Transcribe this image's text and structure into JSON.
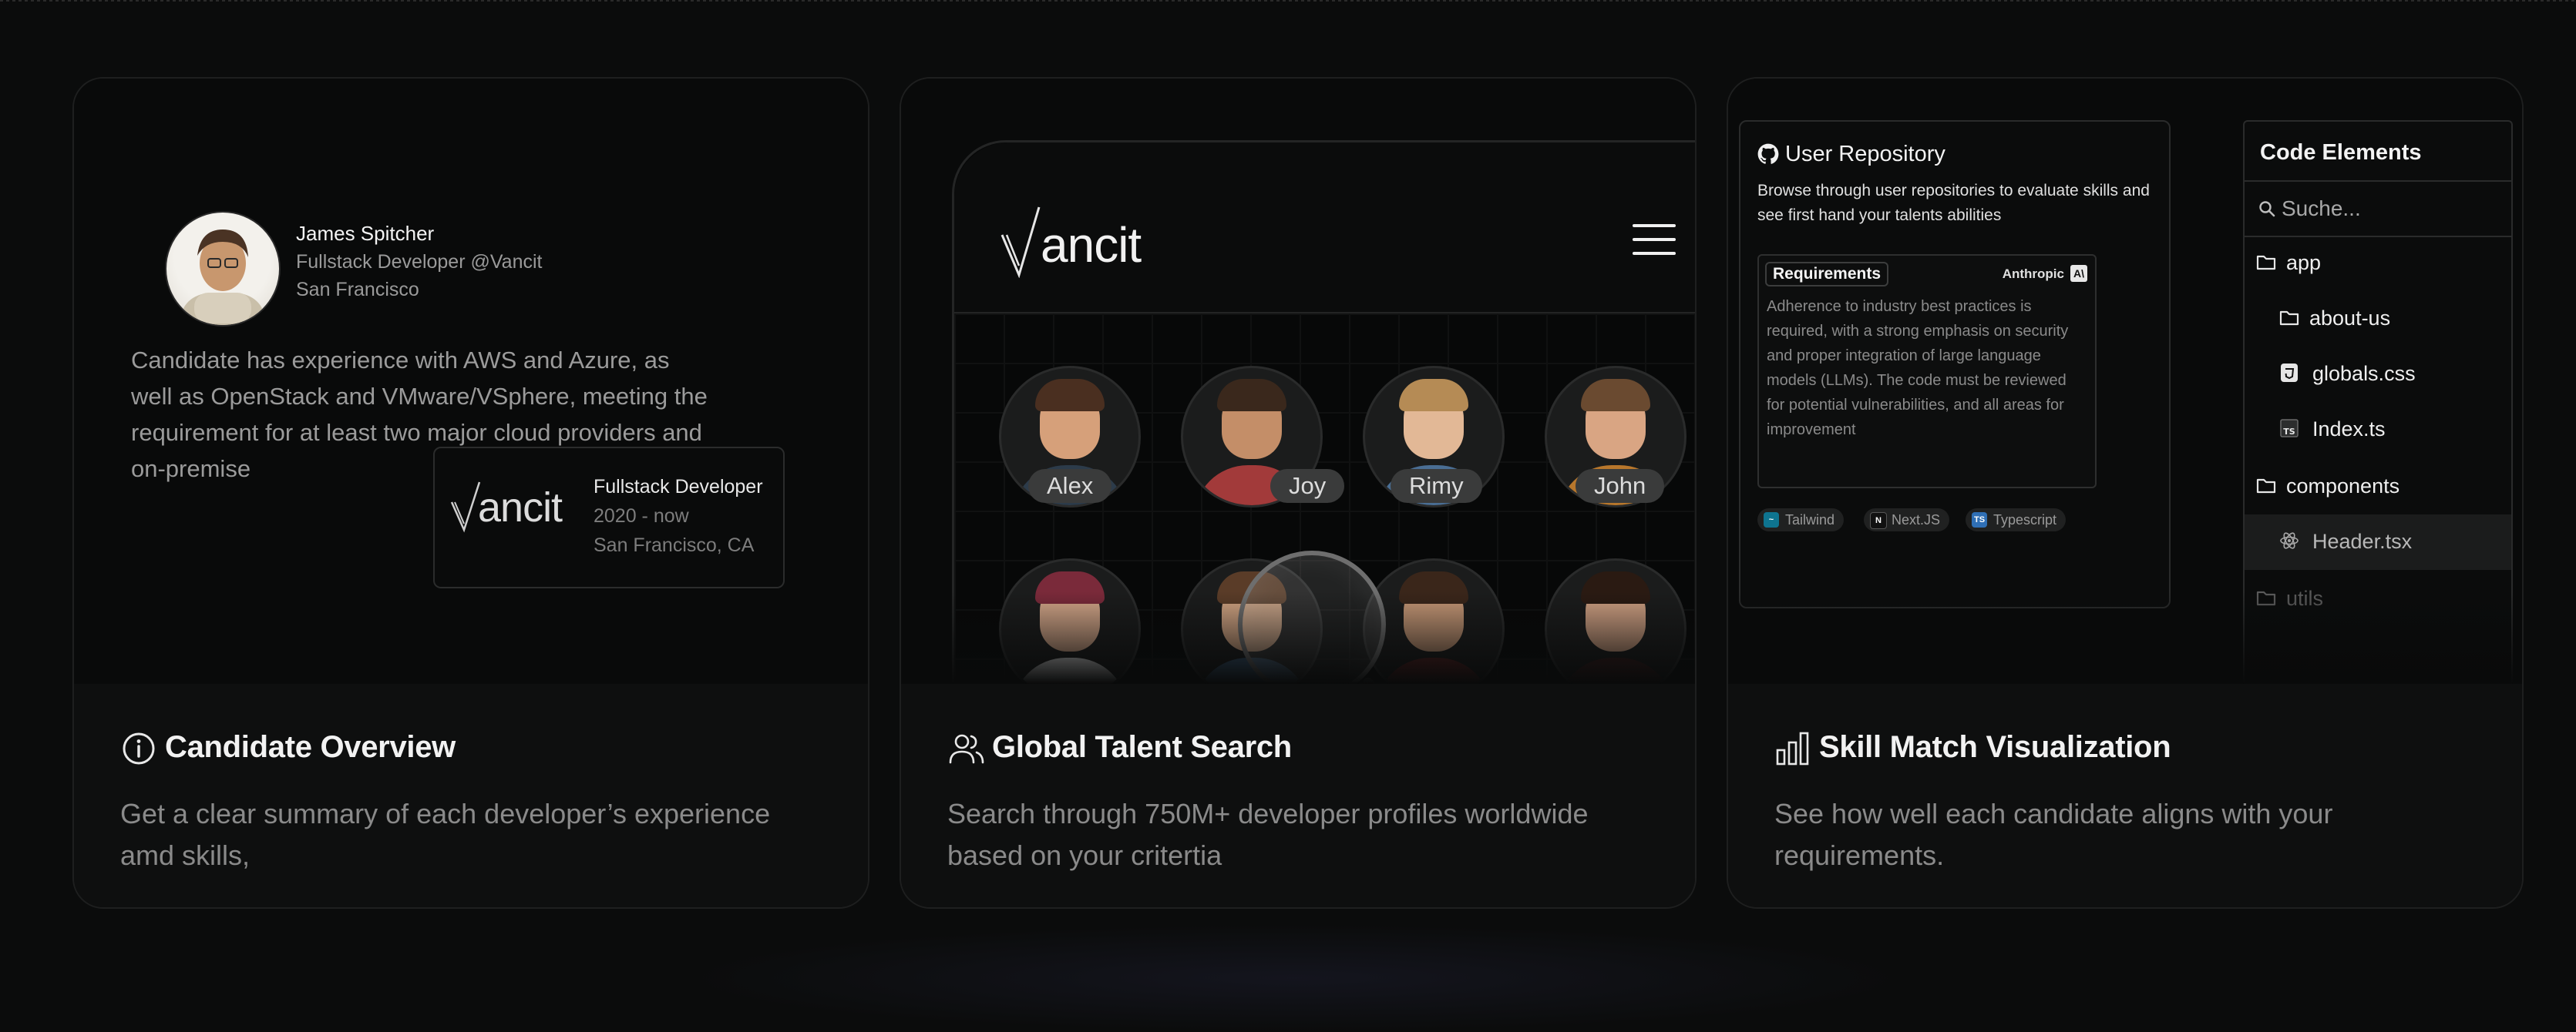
{
  "cards": [
    {
      "title": "Candidate Overview",
      "description": "Get a clear summary of each developer’s experience amd skills,",
      "icon": "info-icon",
      "profile": {
        "name": "James Spitcher",
        "role": "Fullstack Developer @Vancit",
        "location": "San Francisco"
      },
      "summary": "Candidate has experience with AWS and Azure, as well as OpenStack and VMware/VSphere, meeting the requirement for at least two major cloud providers and on-premise",
      "job": {
        "logo": "ancit",
        "title": "Fullstack Developer",
        "years": "2020 - now",
        "location": "San Francisco, CA"
      }
    },
    {
      "title": "Global Talent Search",
      "description": "Search through 750M+ developer profiles worldwide based on your critertia",
      "icon": "users-icon",
      "app_logo": "ancit",
      "people": [
        "Alex",
        "Joy",
        "Rimy",
        "John"
      ]
    },
    {
      "title": "Skill Match Visualization",
      "description": "See how well each candidate aligns with your requirements.",
      "icon": "bar-chart-icon",
      "repo": {
        "title": "User Repository",
        "description": "Browse through user repositories to evaluate skills and see first hand your talents abilities",
        "requirements_label": "Requirements",
        "brand": "Anthropic",
        "brand_mark": "A\\",
        "requirements_text": "Adherence to industry best practices is required, with a strong emphasis on security and proper integration of large language models (LLMs). The code must be reviewed for potential vulnerabilities, and all areas for improvement",
        "tags": [
          "Tailwind",
          "Next.JS",
          "Typescript"
        ]
      },
      "code_elements": {
        "title": "Code Elements",
        "search_placeholder": "Suche...",
        "tree": [
          {
            "label": "app",
            "icon": "folder-icon"
          },
          {
            "label": "about-us",
            "icon": "folder-icon"
          },
          {
            "label": "globals.css",
            "icon": "css-file-icon"
          },
          {
            "label": "Index.ts",
            "icon": "ts-file-icon"
          },
          {
            "label": "components",
            "icon": "folder-icon"
          },
          {
            "label": "Header.tsx",
            "icon": "react-icon",
            "selected": true
          },
          {
            "label": "utils",
            "icon": "folder-icon"
          }
        ]
      }
    }
  ]
}
